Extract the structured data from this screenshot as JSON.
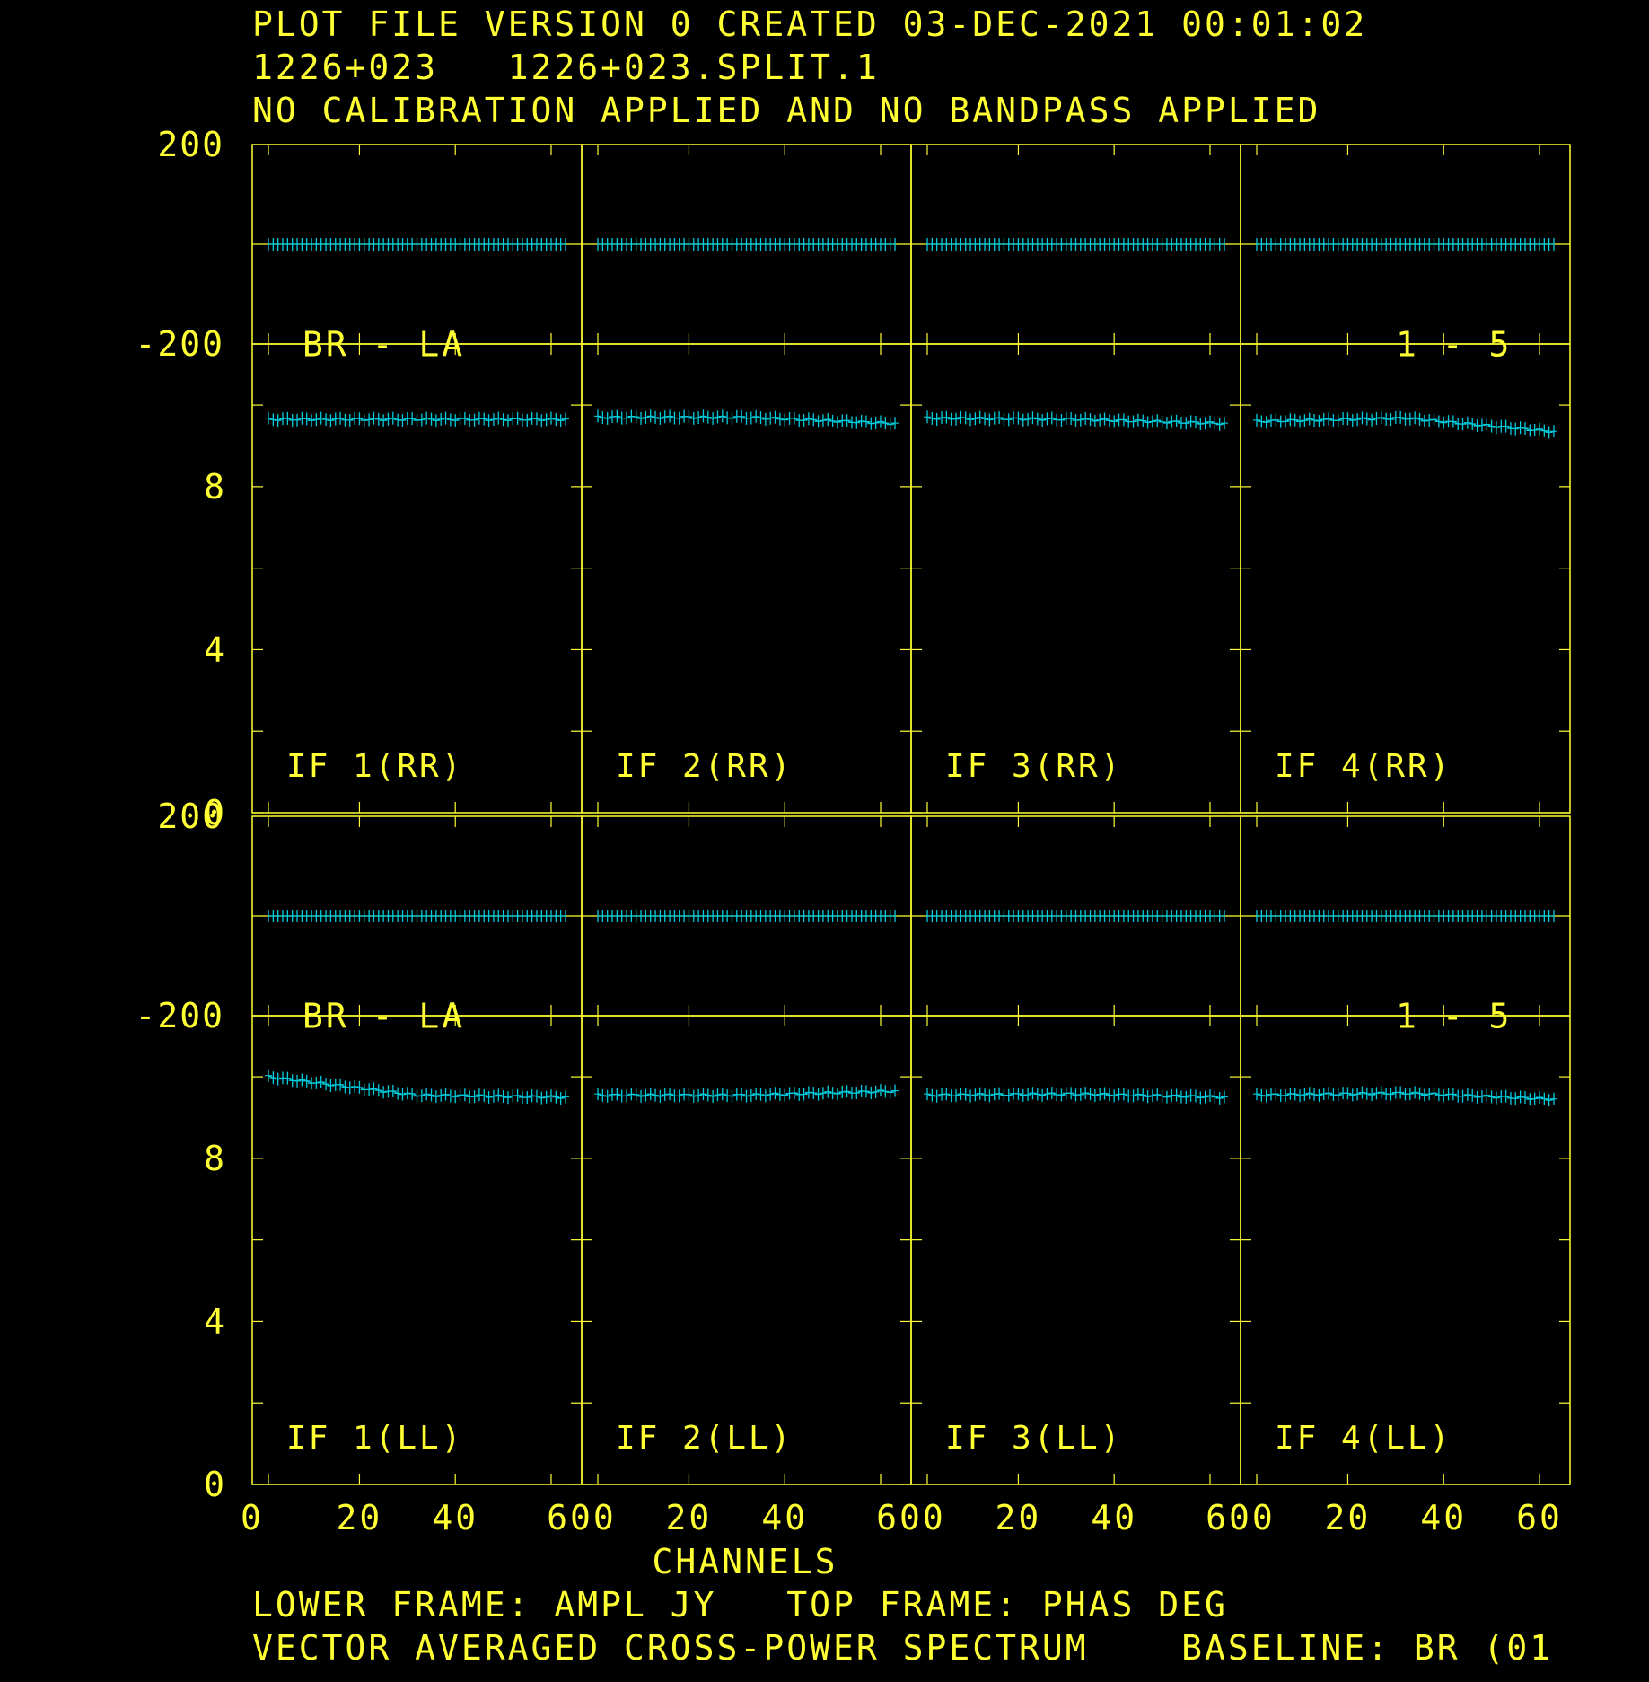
{
  "header": {
    "line1": "PLOT FILE VERSION 0  CREATED 03-DEC-2021 00:01:02",
    "line2": "1226+023   1226+023.SPLIT.1",
    "line3": "NO CALIBRATION APPLIED AND NO BANDPASS APPLIED"
  },
  "footer": {
    "xlabel": "CHANNELS",
    "frames": "LOWER FRAME: AMPL JY   TOP FRAME: PHAS DEG",
    "spectrum": "VECTOR AVERAGED CROSS-POWER SPECTRUM    BASELINE: BR (01"
  },
  "colors": {
    "background": "#000000",
    "axes": "#ffff33",
    "data": "#00ccdd",
    "marker": "#ff66aa"
  },
  "chart_data": {
    "type": "scatter",
    "columns": [
      "IF 1",
      "IF 2",
      "IF 3",
      "IF 4"
    ],
    "rows": [
      {
        "pol": "RR",
        "labels": [
          "IF 1(RR)",
          "IF 2(RR)",
          "IF 3(RR)",
          "IF 4(RR)"
        ],
        "baseline_label": "BR - LA",
        "time_label": "1 - 5",
        "phase_series": [
          {
            "start": 0,
            "end": 0,
            "wobble": 0
          },
          {
            "start": 0,
            "end": 0,
            "wobble": 0
          },
          {
            "start": 0,
            "end": 0,
            "wobble": 0
          },
          {
            "start": 0,
            "end": 0,
            "wobble": 0
          }
        ],
        "amp_series": [
          {
            "start": 9.65,
            "mid": 9.65,
            "end": 9.65
          },
          {
            "start": 9.7,
            "mid": 9.7,
            "end": 9.55
          },
          {
            "start": 9.68,
            "mid": 9.65,
            "end": 9.55
          },
          {
            "start": 9.6,
            "mid": 9.68,
            "end": 9.35
          }
        ]
      },
      {
        "pol": "LL",
        "labels": [
          "IF 1(LL)",
          "IF 2(LL)",
          "IF 3(LL)",
          "IF 4(LL)"
        ],
        "baseline_label": "BR - LA",
        "time_label": "1 - 5",
        "phase_series": [
          {
            "start": 0,
            "end": 0,
            "wobble": 0
          },
          {
            "start": 0,
            "end": 0,
            "wobble": 0
          },
          {
            "start": 0,
            "end": 0,
            "wobble": 0
          },
          {
            "start": 0,
            "end": 0,
            "wobble": 0
          }
        ],
        "amp_series": [
          {
            "start": 10.0,
            "mid": 9.55,
            "end": 9.5
          },
          {
            "start": 9.55,
            "mid": 9.55,
            "end": 9.65
          },
          {
            "start": 9.55,
            "mid": 9.58,
            "end": 9.5
          },
          {
            "start": 9.55,
            "mid": 9.6,
            "end": 9.45
          }
        ]
      }
    ],
    "channels": [
      1,
      63
    ],
    "x_ticks": [
      "0",
      "20",
      "40",
      "600",
      "20",
      "40",
      "600",
      "20",
      "40",
      "600",
      "20",
      "40",
      "60"
    ],
    "phase_axis": {
      "ylim": [
        -200,
        200
      ],
      "ticks": [
        "200",
        "-200"
      ]
    },
    "amp_axis": {
      "ylim": [
        0,
        11.5
      ],
      "ticks": [
        "8",
        "4",
        "0"
      ]
    },
    "frame_labels": {
      "lower": "AMPL JY",
      "top": "PHAS DEG"
    }
  }
}
